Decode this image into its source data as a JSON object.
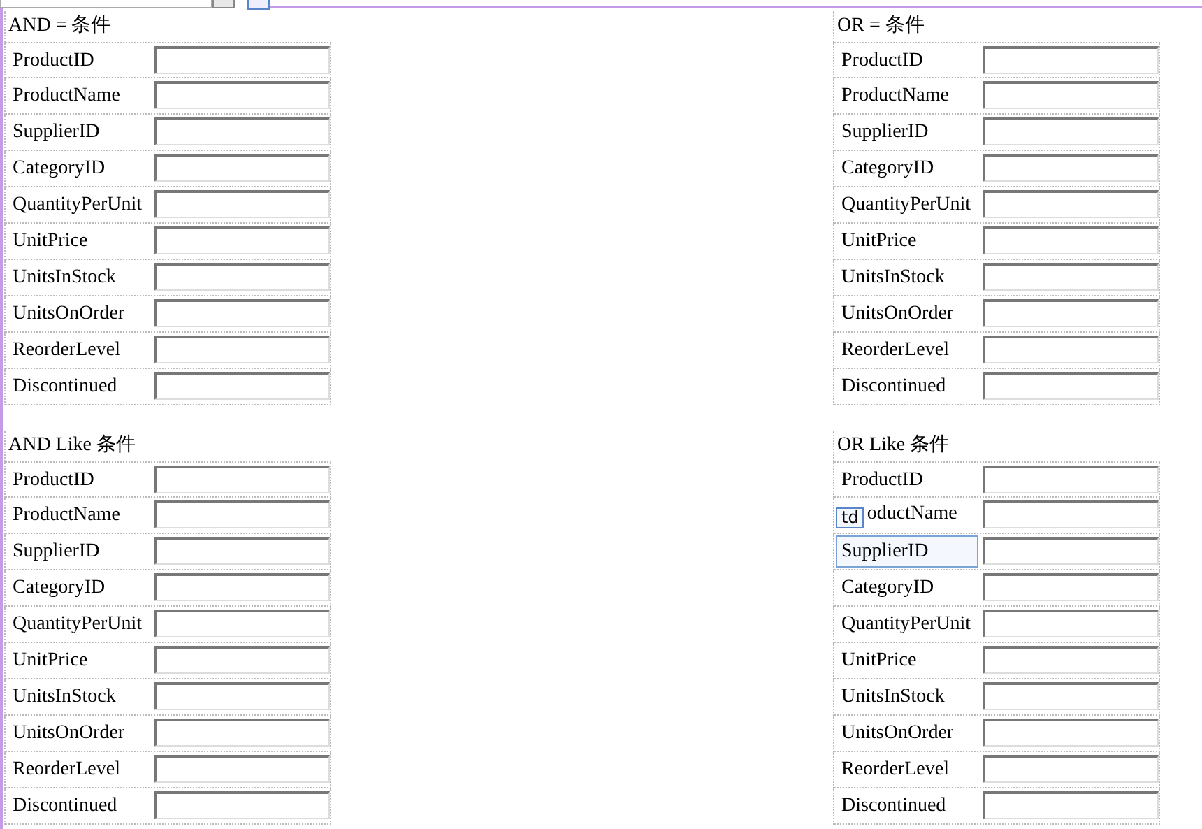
{
  "selection_tag": "td",
  "groups": [
    {
      "title": "AND = 条件",
      "fields": [
        {
          "label": "ProductID",
          "selected": false
        },
        {
          "label": "ProductName",
          "selected": false
        },
        {
          "label": "SupplierID",
          "selected": false
        },
        {
          "label": "CategoryID",
          "selected": false
        },
        {
          "label": "QuantityPerUnit",
          "selected": false
        },
        {
          "label": "UnitPrice",
          "selected": false
        },
        {
          "label": "UnitsInStock",
          "selected": false
        },
        {
          "label": "UnitsOnOrder",
          "selected": false
        },
        {
          "label": "ReorderLevel",
          "selected": false
        },
        {
          "label": "Discontinued",
          "selected": false
        }
      ]
    },
    {
      "title": "OR = 条件",
      "fields": [
        {
          "label": "ProductID",
          "selected": false
        },
        {
          "label": "ProductName",
          "selected": false
        },
        {
          "label": "SupplierID",
          "selected": false
        },
        {
          "label": "CategoryID",
          "selected": false
        },
        {
          "label": "QuantityPerUnit",
          "selected": false
        },
        {
          "label": "UnitPrice",
          "selected": false
        },
        {
          "label": "UnitsInStock",
          "selected": false
        },
        {
          "label": "UnitsOnOrder",
          "selected": false
        },
        {
          "label": "ReorderLevel",
          "selected": false
        },
        {
          "label": "Discontinued",
          "selected": false
        }
      ]
    },
    {
      "title": "AND Like 条件",
      "fields": [
        {
          "label": "ProductID",
          "selected": false
        },
        {
          "label": "ProductName",
          "selected": false
        },
        {
          "label": "SupplierID",
          "selected": false
        },
        {
          "label": "CategoryID",
          "selected": false
        },
        {
          "label": "QuantityPerUnit",
          "selected": false
        },
        {
          "label": "UnitPrice",
          "selected": false
        },
        {
          "label": "UnitsInStock",
          "selected": false
        },
        {
          "label": "UnitsOnOrder",
          "selected": false
        },
        {
          "label": "ReorderLevel",
          "selected": false
        },
        {
          "label": "Discontinued",
          "selected": false
        }
      ]
    },
    {
      "title": "OR Like 条件",
      "fields": [
        {
          "label": "ProductID",
          "selected": false
        },
        {
          "label": "oductName",
          "selected": false
        },
        {
          "label": "SupplierID",
          "selected": true
        },
        {
          "label": "CategoryID",
          "selected": false
        },
        {
          "label": "QuantityPerUnit",
          "selected": false
        },
        {
          "label": "UnitPrice",
          "selected": false
        },
        {
          "label": "UnitsInStock",
          "selected": false
        },
        {
          "label": "UnitsOnOrder",
          "selected": false
        },
        {
          "label": "ReorderLevel",
          "selected": false
        },
        {
          "label": "Discontinued",
          "selected": false
        }
      ]
    }
  ]
}
